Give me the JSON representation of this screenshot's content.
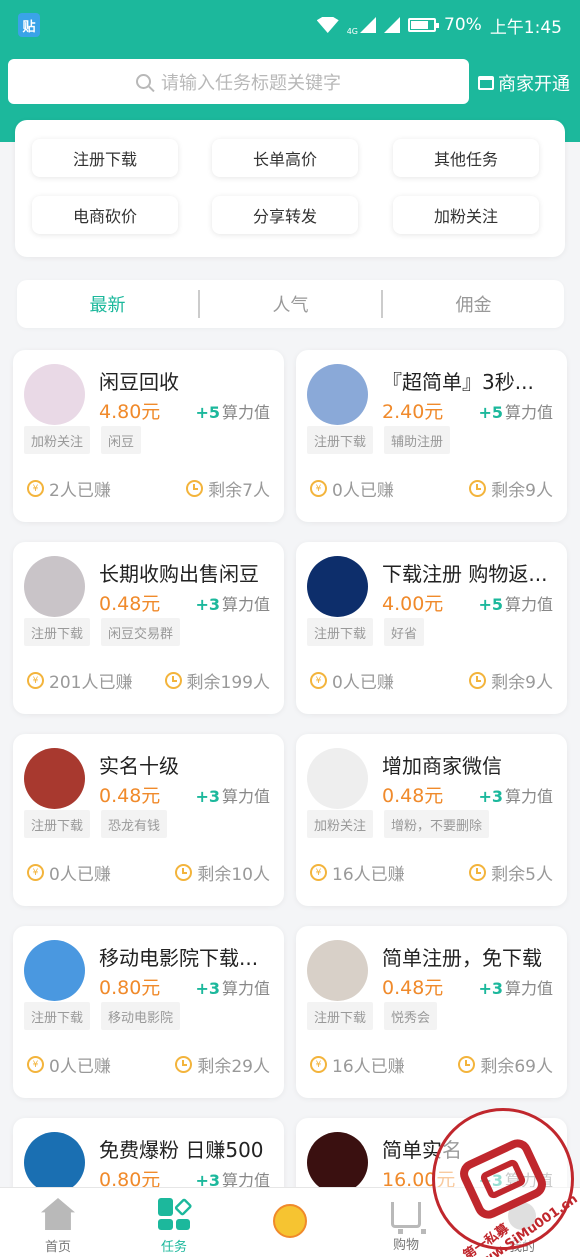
{
  "status_bar": {
    "badge": "贴",
    "network": "4G",
    "battery": "70%",
    "time": "上午1:45"
  },
  "header": {
    "search_placeholder": "请输入任务标题关键字",
    "merchant_label": "商家开通"
  },
  "categories": [
    "注册下载",
    "长单高价",
    "其他任务",
    "电商砍价",
    "分享转发",
    "加粉关注"
  ],
  "sort_tabs": [
    "最新",
    "人气",
    "佣金"
  ],
  "tasks": [
    {
      "title": "闲豆回收",
      "price": "4.80元",
      "bonus": "+5",
      "bonus_unit": "算力值",
      "tags": [
        "加粉关注",
        "闲豆"
      ],
      "earned": "2人已赚",
      "remaining": "剩余7人",
      "avatar_color": "#e9d9e6"
    },
    {
      "title": "『超简单』3秒...",
      "price": "2.40元",
      "bonus": "+5",
      "bonus_unit": "算力值",
      "tags": [
        "注册下载",
        "辅助注册"
      ],
      "earned": "0人已赚",
      "remaining": "剩余9人",
      "avatar_color": "#8aa9d8"
    },
    {
      "title": "长期收购出售闲豆",
      "price": "0.48元",
      "bonus": "+3",
      "bonus_unit": "算力值",
      "tags": [
        "注册下载",
        "闲豆交易群"
      ],
      "earned": "201人已赚",
      "remaining": "剩余199人",
      "avatar_color": "#c9c4c8"
    },
    {
      "title": "下载注册 购物返...",
      "price": "4.00元",
      "bonus": "+5",
      "bonus_unit": "算力值",
      "tags": [
        "注册下载",
        "好省"
      ],
      "earned": "0人已赚",
      "remaining": "剩余9人",
      "avatar_color": "#0d2e6b"
    },
    {
      "title": "实名十级",
      "price": "0.48元",
      "bonus": "+3",
      "bonus_unit": "算力值",
      "tags": [
        "注册下载",
        "恐龙有钱"
      ],
      "earned": "0人已赚",
      "remaining": "剩余10人",
      "avatar_color": "#a8392f"
    },
    {
      "title": "增加商家微信",
      "price": "0.48元",
      "bonus": "+3",
      "bonus_unit": "算力值",
      "tags": [
        "加粉关注",
        "增粉，不要删除"
      ],
      "earned": "16人已赚",
      "remaining": "剩余5人",
      "avatar_color": "#eeeeee"
    },
    {
      "title": "移动电影院下载...",
      "price": "0.80元",
      "bonus": "+3",
      "bonus_unit": "算力值",
      "tags": [
        "注册下载",
        "移动电影院"
      ],
      "earned": "0人已赚",
      "remaining": "剩余29人",
      "avatar_color": "#4a98e0"
    },
    {
      "title": "简单注册，免下载",
      "price": "0.48元",
      "bonus": "+3",
      "bonus_unit": "算力值",
      "tags": [
        "注册下载",
        "悦秀会"
      ],
      "earned": "16人已赚",
      "remaining": "剩余69人",
      "avatar_color": "#d8d0c8"
    },
    {
      "title": "免费爆粉 日赚500",
      "price": "0.80元",
      "bonus": "+3",
      "bonus_unit": "算力值",
      "tags": [],
      "earned": "",
      "remaining": "",
      "avatar_color": "#1a6fb2"
    },
    {
      "title": "简单实名",
      "price": "16.00元",
      "bonus": "+3",
      "bonus_unit": "算力值",
      "tags": [],
      "earned": "",
      "remaining": "",
      "avatar_color": "#3a1010"
    }
  ],
  "bottom_nav": [
    "首页",
    "任务",
    "",
    "购物",
    "我的"
  ],
  "watermark": {
    "text": "第一私募 www.SiMu001.cn"
  },
  "colors": {
    "brand": "#1cb89c",
    "price": "#f08a2b",
    "coin": "#f3b43c"
  },
  "icons": [
    "search-icon",
    "store-icon",
    "coin-icon",
    "clock-icon",
    "home-icon",
    "task-icon",
    "mascot-icon",
    "cart-icon",
    "profile-icon"
  ]
}
